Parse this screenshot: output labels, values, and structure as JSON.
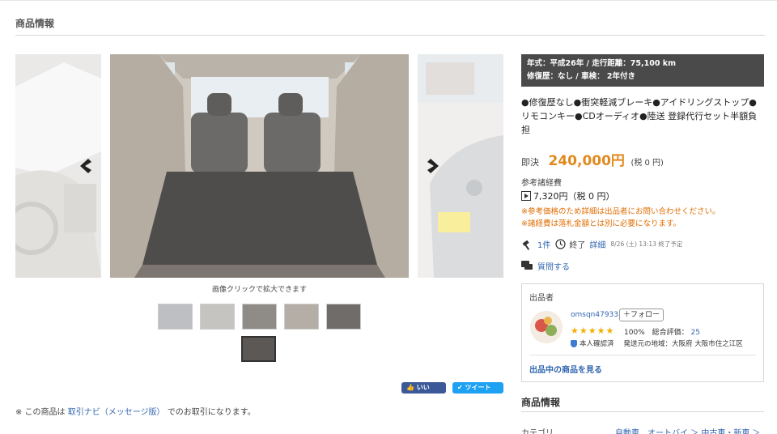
{
  "section": {
    "title": "商品情報"
  },
  "gallery": {
    "caption": "画像クリックで拡大できます"
  },
  "spec": {
    "line1": "年式：平成26年 / 走行距離：75,100 km",
    "line2": "修復歴：なし / 車検： 2年付き"
  },
  "features": "●修復歴なし●衝突軽減ブレーキ●アイドリングストップ●リモコンキー●CDオーディオ●陸送 登録代行セット半額負担",
  "price": {
    "label": "即決",
    "amount": "240,000円",
    "tax": "(税 0 円)"
  },
  "fees": {
    "title": "参考諸経費",
    "amount": "7,320円（税 0 円）",
    "warn1": "※参考価格のため詳細は出品者にお問い合わせください。",
    "warn2": "※諸経費は落札金額とは別に必要になります。"
  },
  "auction": {
    "bids": "1件",
    "end_label": "終了",
    "detail": "詳細",
    "end_time": "8/26 (土) 13:13 終了予定"
  },
  "question": "質問する",
  "seller": {
    "title": "出品者",
    "name": "omsqn47933",
    "follow": "＋フォロー",
    "stars": "★★★★★",
    "percent": "100%",
    "total_label": "総合評価：",
    "total": "25",
    "verified": "本人確認済",
    "region": "発送元の地域：大阪府 大阪市住之江区",
    "items_link": "出品中の商品を見る"
  },
  "social": {
    "like": "いいね！",
    "tweet": "ツイート"
  },
  "note": {
    "prefix": "※ この商品は",
    "link": "取引ナビ（メッセージ版）",
    "suffix": "でのお取引になります。"
  },
  "info": {
    "title": "商品情報",
    "category_label": "カテゴリ",
    "category_value": "自動車、オートバイ ＞ 中古車・新車 ＞"
  },
  "colors": {
    "price": "#e08a1e",
    "link": "#3266b0",
    "warning": "#e06c00",
    "spec_bg": "#4a4a4a"
  }
}
